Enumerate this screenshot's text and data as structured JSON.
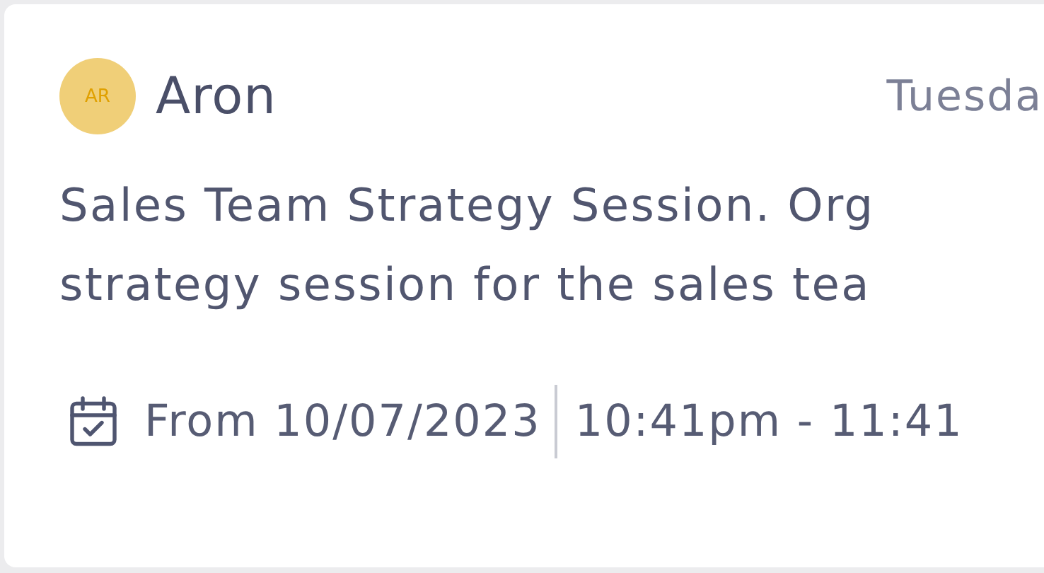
{
  "card": {
    "avatar": {
      "initials": "AR",
      "color": "#f0cf78"
    },
    "author": "Aron",
    "day": "Tuesda",
    "description_lines": [
      "Sales Team Strategy Session. Org",
      "strategy session for the sales tea"
    ],
    "date": "From 10/07/2023",
    "time": "10:41pm - 11:41"
  }
}
